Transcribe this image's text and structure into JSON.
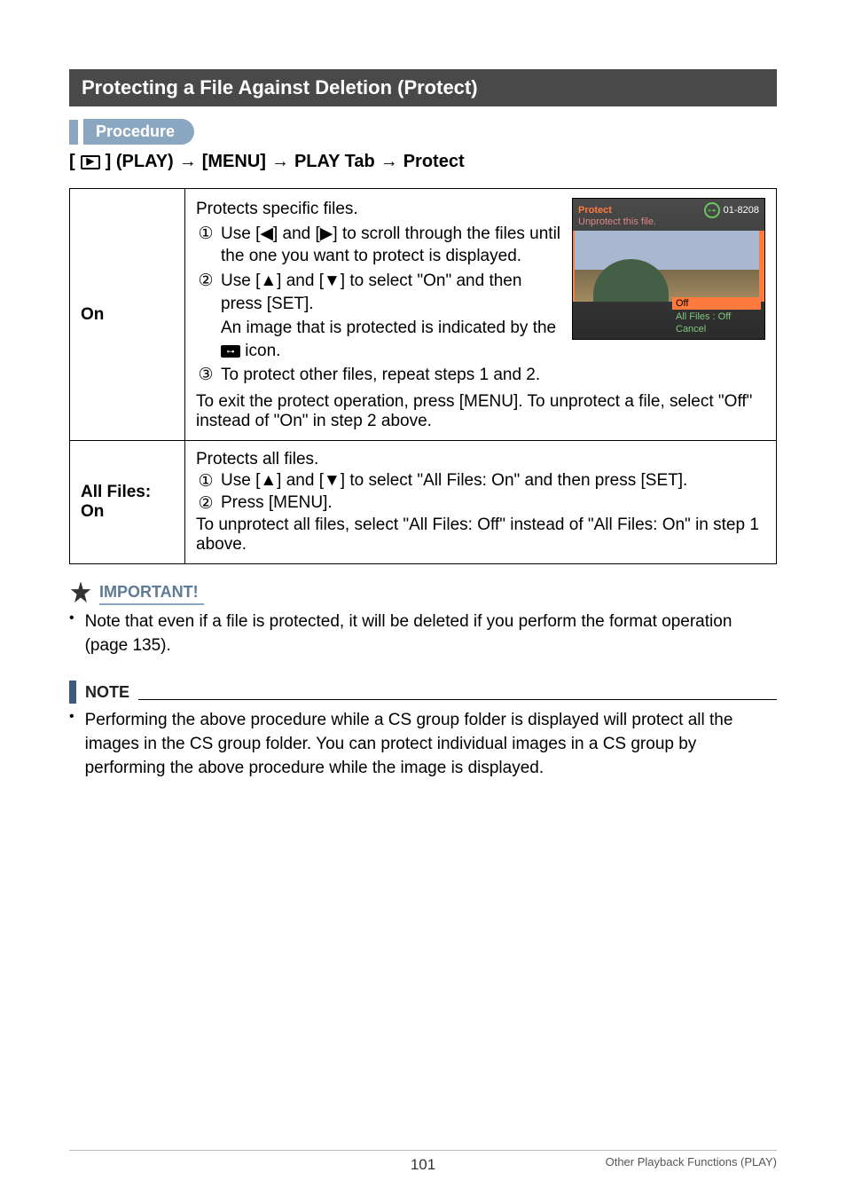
{
  "header": {
    "title": "Protecting a File Against Deletion (Protect)"
  },
  "procedure": {
    "label": "Procedure",
    "crumbs": {
      "prefix_open": "[",
      "play_word": "] (PLAY)",
      "menu": "[MENU]",
      "tab": "PLAY Tab",
      "protect": "Protect"
    }
  },
  "table": {
    "rows": [
      {
        "label": "On",
        "intro": "Protects specific files.",
        "steps": [
          {
            "n": "①",
            "t": "Use [◀] and [▶] to scroll through the files until the one you want to protect is displayed."
          },
          {
            "n": "②",
            "t": "Use [▲] and [▼] to select \"On\" and then press [SET]."
          },
          {
            "n": "",
            "t": "An image that is protected is indicated by the ",
            "icon": true,
            "t2": " icon."
          },
          {
            "n": "③",
            "t": "To protect other files, repeat steps 1 and 2."
          }
        ],
        "outro": "To exit the protect operation, press [MENU]. To unprotect a file, select \"Off\" instead of \"On\" in step 2 above.",
        "mini": {
          "title": "Protect",
          "counter": "01-8208",
          "sub": "Unprotect this file.",
          "menu": [
            "Off",
            "All Files : Off",
            "Cancel"
          ]
        }
      },
      {
        "label": "All Files: On",
        "intro": "Protects all files.",
        "steps": [
          {
            "n": "①",
            "t": "Use [▲] and [▼] to select \"All Files: On\" and then press [SET]."
          },
          {
            "n": "②",
            "t": "Press [MENU]."
          }
        ],
        "outro": "To unprotect all files, select \"All Files: Off\" instead of \"All Files: On\" in step 1 above."
      }
    ]
  },
  "important": {
    "label": "IMPORTANT!",
    "text": "Note that even if a file is protected, it will be deleted if you perform the format operation (page 135)."
  },
  "note": {
    "label": "NOTE",
    "text": "Performing the above procedure while a CS group folder is displayed will protect all the images in the CS group folder. You can protect individual images in a CS group by performing the above procedure while the image is displayed."
  },
  "footer": {
    "page": "101",
    "section": "Other Playback Functions (PLAY)"
  }
}
